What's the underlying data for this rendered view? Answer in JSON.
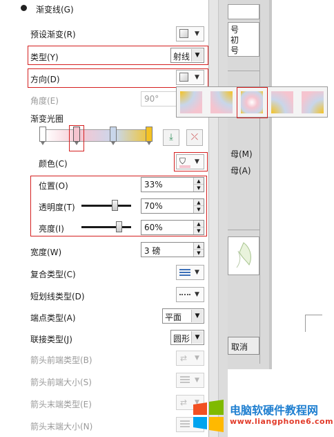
{
  "panel": {
    "gradient_line_label": "渐变线(G)",
    "preset_gradient_label": "预设渐变(R)",
    "type_label": "类型(Y)",
    "type_value": "射线",
    "direction_label": "方向(D)",
    "angle_label": "角度(E)",
    "angle_value": "90°",
    "gradient_stops_label": "渐变光圈",
    "color_label": "颜色(C)",
    "position_label": "位置(O)",
    "position_value": "33%",
    "transparency_label": "透明度(T)",
    "transparency_value": "70%",
    "transparency_level": 0.7,
    "brightness_label": "亮度(I)",
    "brightness_value": "60%",
    "brightness_level": 0.8,
    "width_label": "宽度(W)",
    "width_value": "3 磅",
    "compound_type_label": "复合类型(C)",
    "dash_type_label": "短划线类型(D)",
    "cap_type_label": "端点类型(A)",
    "cap_type_value": "平面",
    "join_type_label": "联接类型(J)",
    "join_type_value": "圆形",
    "arrow_begin_type_label": "箭头前端类型(B)",
    "arrow_begin_size_label": "箭头前端大小(S)",
    "arrow_end_type_label": "箭头末端类型(E)",
    "arrow_end_size_label": "箭头末端大小(N)"
  },
  "gradient_stops": [
    {
      "color": "#ffffff",
      "position": 0
    },
    {
      "color": "#f5c4cf",
      "position": 0.33
    },
    {
      "color": "#c8d6ea",
      "position": 0.66
    },
    {
      "color": "#f4c224",
      "position": 1
    }
  ],
  "direction_presets": [
    "corner-bottom-right",
    "corner-bottom-left",
    "center",
    "corner-top-right",
    "corner-top-left"
  ],
  "selected_direction": "center",
  "dialog": {
    "list_items": [
      "号",
      "初",
      "号"
    ],
    "option_m": "母(M)",
    "option_a": "母(A)",
    "cancel_label": "取消"
  },
  "branding": {
    "title": "电脑软硬件教程网",
    "url": "www.liangphone6.com"
  },
  "colors": {
    "highlight_red": "#d41e1e",
    "brand_blue": "#1f7fd0",
    "brand_red": "#e23b2a"
  }
}
